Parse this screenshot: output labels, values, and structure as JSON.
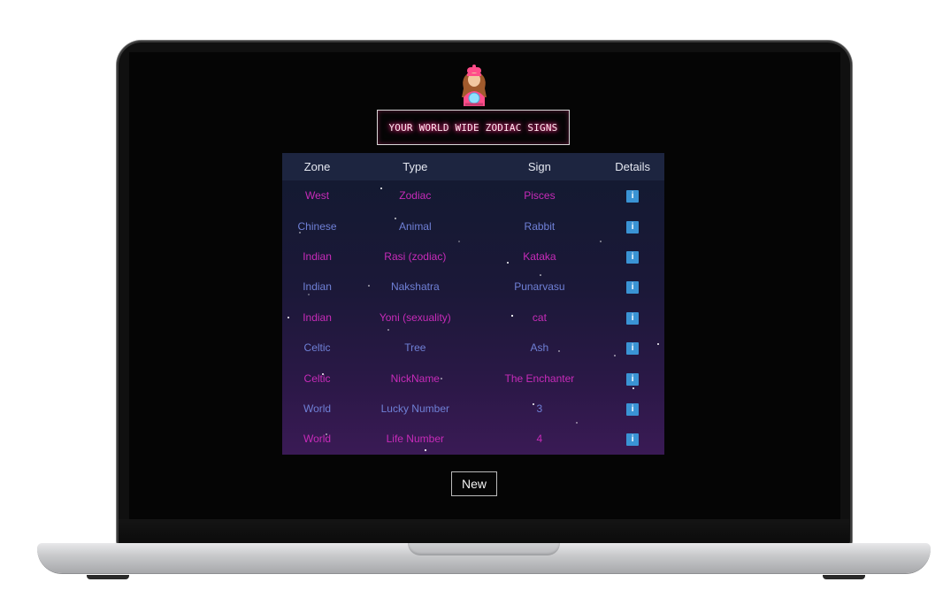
{
  "header": {
    "title": "YOUR WORLD WIDE ZODIAC SIGNS"
  },
  "table": {
    "columns": [
      "Zone",
      "Type",
      "Sign",
      "Details"
    ],
    "rows": [
      {
        "zone": "West",
        "type": "Zodiac",
        "sign": "Pisces",
        "details": "i",
        "style": "pink"
      },
      {
        "zone": "Chinese",
        "type": "Animal",
        "sign": "Rabbit",
        "details": "i",
        "style": "blue"
      },
      {
        "zone": "Indian",
        "type": "Rasi (zodiac)",
        "sign": "Kataka",
        "details": "i",
        "style": "pink"
      },
      {
        "zone": "Indian",
        "type": "Nakshatra",
        "sign": "Punarvasu",
        "details": "i",
        "style": "blue"
      },
      {
        "zone": "Indian",
        "type": "Yoni (sexuality)",
        "sign": "cat",
        "details": "i",
        "style": "pink"
      },
      {
        "zone": "Celtic",
        "type": "Tree",
        "sign": "Ash",
        "details": "i",
        "style": "blue"
      },
      {
        "zone": "Celtic",
        "type": "NickName",
        "sign": "The Enchanter",
        "details": "i",
        "style": "pink"
      },
      {
        "zone": "World",
        "type": "Lucky Number",
        "sign": "3",
        "details": "i",
        "style": "blue"
      },
      {
        "zone": "World",
        "type": "Life Number",
        "sign": "4",
        "details": "i",
        "style": "pink"
      }
    ]
  },
  "actions": {
    "new_label": "New"
  },
  "icons": {
    "avatar": "fortune-teller-icon",
    "details": "info-icon"
  },
  "colors": {
    "title_glow": "#ff2f8a",
    "row_pink": "#c72bb9",
    "row_blue": "#6f80d6",
    "info_button": "#3a93d4"
  }
}
